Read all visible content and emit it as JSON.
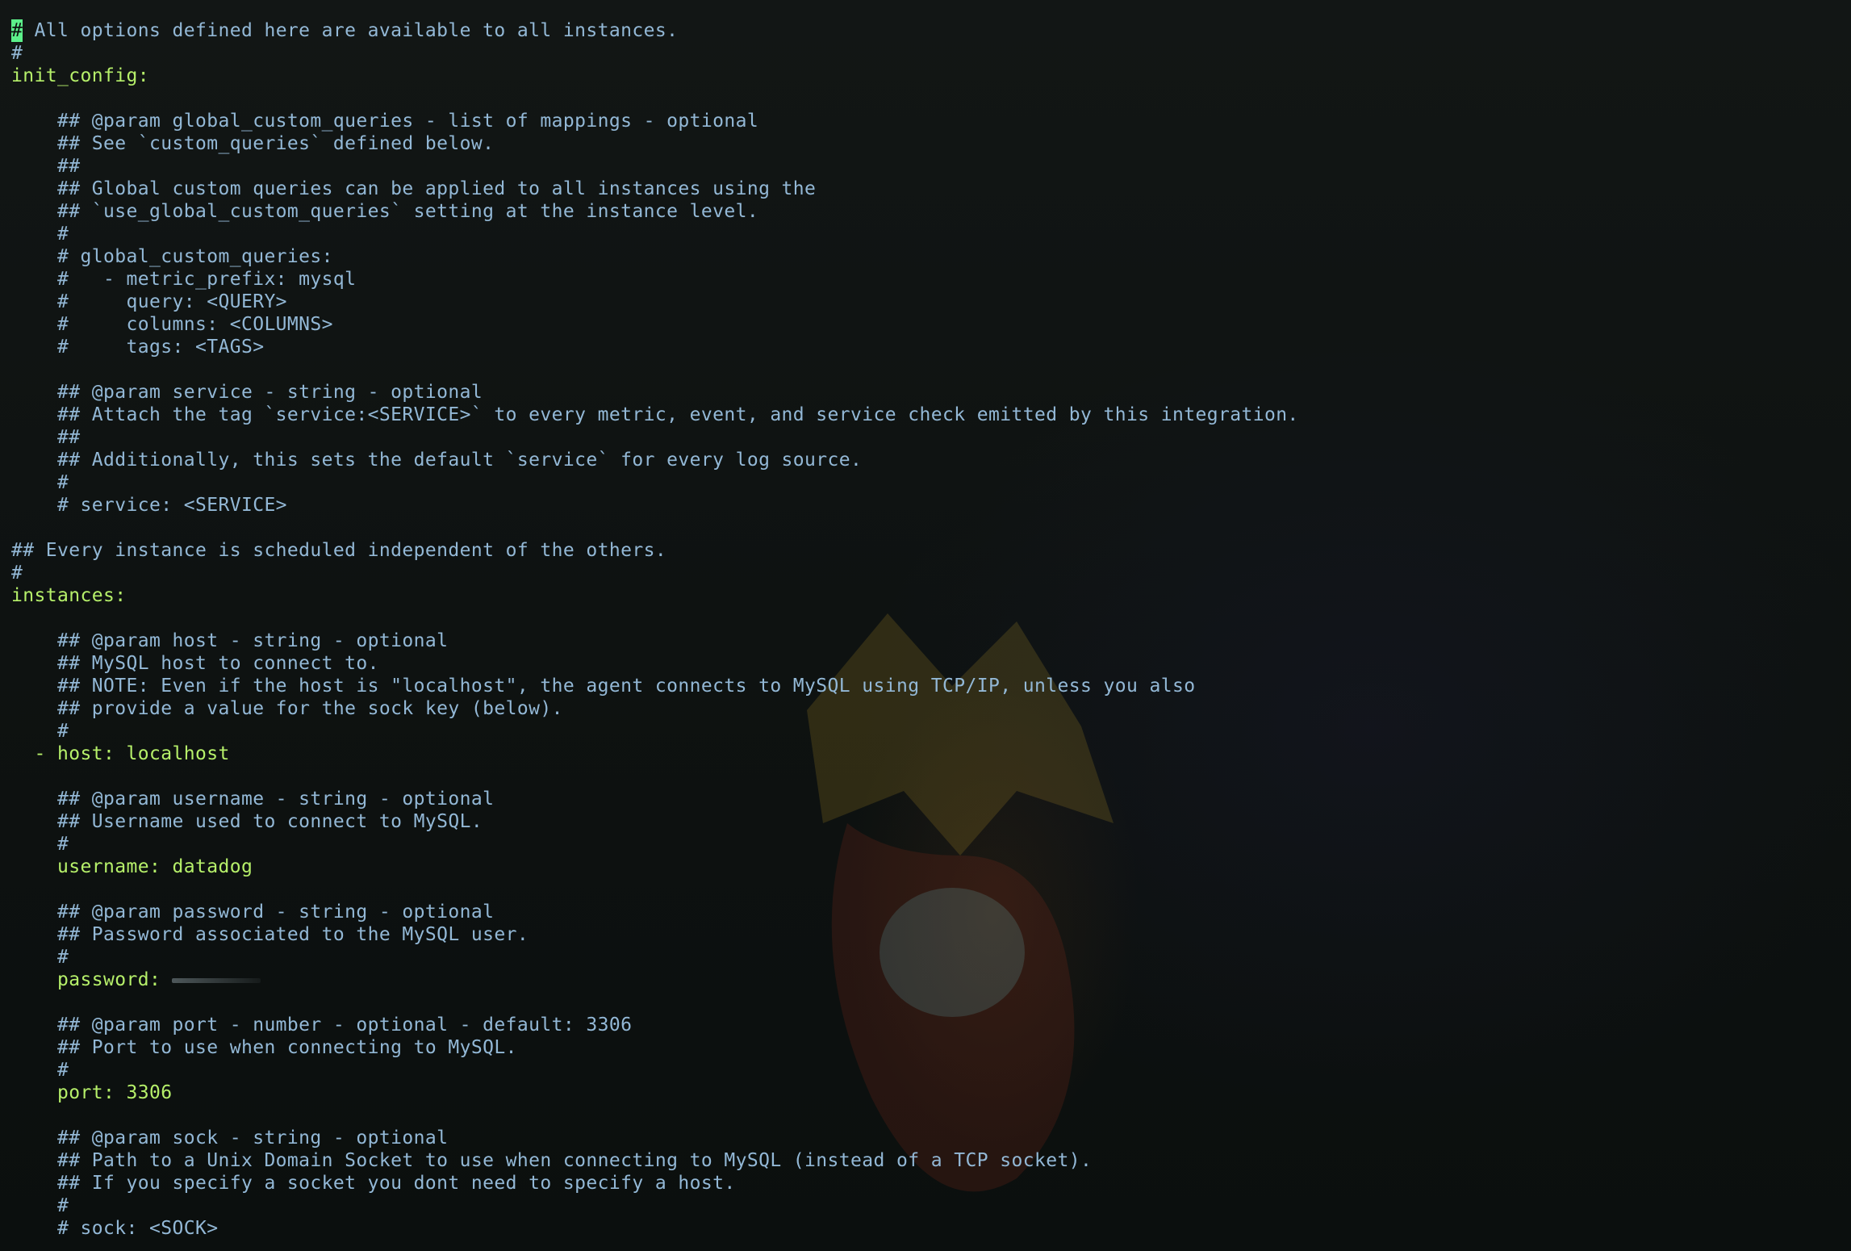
{
  "cursor_char": "#",
  "lines": [
    {
      "text": "# All options defined here are available to all instances.",
      "kind": "comment",
      "cursor": true
    },
    {
      "text": "#",
      "kind": "comment"
    },
    {
      "text": "init_config:",
      "kind": "key"
    },
    {
      "text": "",
      "kind": "blank"
    },
    {
      "text": "    ## @param global_custom_queries - list of mappings - optional",
      "kind": "comment"
    },
    {
      "text": "    ## See `custom_queries` defined below.",
      "kind": "comment"
    },
    {
      "text": "    ##",
      "kind": "comment"
    },
    {
      "text": "    ## Global custom queries can be applied to all instances using the",
      "kind": "comment"
    },
    {
      "text": "    ## `use_global_custom_queries` setting at the instance level.",
      "kind": "comment"
    },
    {
      "text": "    #",
      "kind": "comment"
    },
    {
      "text": "    # global_custom_queries:",
      "kind": "comment"
    },
    {
      "text": "    #   - metric_prefix: mysql",
      "kind": "comment"
    },
    {
      "text": "    #     query: <QUERY>",
      "kind": "comment"
    },
    {
      "text": "    #     columns: <COLUMNS>",
      "kind": "comment"
    },
    {
      "text": "    #     tags: <TAGS>",
      "kind": "comment"
    },
    {
      "text": "",
      "kind": "blank"
    },
    {
      "text": "    ## @param service - string - optional",
      "kind": "comment"
    },
    {
      "text": "    ## Attach the tag `service:<SERVICE>` to every metric, event, and service check emitted by this integration.",
      "kind": "comment"
    },
    {
      "text": "    ##",
      "kind": "comment"
    },
    {
      "text": "    ## Additionally, this sets the default `service` for every log source.",
      "kind": "comment"
    },
    {
      "text": "    #",
      "kind": "comment"
    },
    {
      "text": "    # service: <SERVICE>",
      "kind": "comment"
    },
    {
      "text": "",
      "kind": "blank"
    },
    {
      "text": "## Every instance is scheduled independent of the others.",
      "kind": "comment"
    },
    {
      "text": "#",
      "kind": "comment"
    },
    {
      "text": "instances:",
      "kind": "key"
    },
    {
      "text": "",
      "kind": "blank"
    },
    {
      "text": "    ## @param host - string - optional",
      "kind": "comment"
    },
    {
      "text": "    ## MySQL host to connect to.",
      "kind": "comment"
    },
    {
      "text": "    ## NOTE: Even if the host is \"localhost\", the agent connects to MySQL using TCP/IP, unless you also",
      "kind": "comment"
    },
    {
      "text": "    ## provide a value for the sock key (below).",
      "kind": "comment"
    },
    {
      "text": "    #",
      "kind": "comment"
    },
    {
      "text": "  - host: localhost",
      "kind": "key"
    },
    {
      "text": "",
      "kind": "blank"
    },
    {
      "text": "    ## @param username - string - optional",
      "kind": "comment"
    },
    {
      "text": "    ## Username used to connect to MySQL.",
      "kind": "comment"
    },
    {
      "text": "    #",
      "kind": "comment"
    },
    {
      "text": "    username: datadog",
      "kind": "key"
    },
    {
      "text": "",
      "kind": "blank"
    },
    {
      "text": "    ## @param password - string - optional",
      "kind": "comment"
    },
    {
      "text": "    ## Password associated to the MySQL user.",
      "kind": "comment"
    },
    {
      "text": "    #",
      "kind": "comment"
    },
    {
      "text": "    password: ",
      "kind": "key",
      "masked": true
    },
    {
      "text": "",
      "kind": "blank"
    },
    {
      "text": "    ## @param port - number - optional - default: 3306",
      "kind": "comment"
    },
    {
      "text": "    ## Port to use when connecting to MySQL.",
      "kind": "comment"
    },
    {
      "text": "    #",
      "kind": "comment"
    },
    {
      "text": "    port: 3306",
      "kind": "key"
    },
    {
      "text": "",
      "kind": "blank"
    },
    {
      "text": "    ## @param sock - string - optional",
      "kind": "comment"
    },
    {
      "text": "    ## Path to a Unix Domain Socket to use when connecting to MySQL (instead of a TCP socket).",
      "kind": "comment"
    },
    {
      "text": "    ## If you specify a socket you dont need to specify a host.",
      "kind": "comment"
    },
    {
      "text": "    #",
      "kind": "comment"
    },
    {
      "text": "    # sock: <SOCK>",
      "kind": "comment"
    }
  ],
  "colors": {
    "comment": "#93b8d6",
    "key": "#b6f06a",
    "cursor": "#5cf08a",
    "background": "#0d1110"
  }
}
